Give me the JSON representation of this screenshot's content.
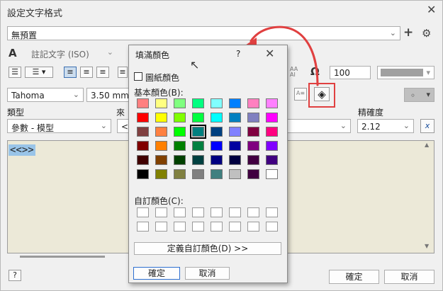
{
  "window": {
    "title": "設定文字格式"
  },
  "style_combo": {
    "value": "無預置"
  },
  "text_style": {
    "value": "註記文字 (ISO)"
  },
  "font": {
    "value": "Tahoma"
  },
  "size": {
    "value": "3.50 mm"
  },
  "width_value": "100",
  "type_label": "類型",
  "source_label_partial": "來",
  "type_combo": {
    "value": "參數 - 模型"
  },
  "precision_label": "精確度",
  "precision_combo": {
    "value": "2.12"
  },
  "source_partial_value": "<",
  "editor_text": "<<>>",
  "small_combo_value": "◦",
  "footer": {
    "ok": "確定",
    "cancel": "取消"
  },
  "popup": {
    "title": "填滿顏色",
    "help": "?",
    "checkbox_label": "圖紙顏色",
    "basic_label": "基本顏色(B):",
    "custom_label": "自訂顏色(C):",
    "define_button": "定義自訂顏色(D) >>",
    "ok": "確定",
    "cancel": "取消"
  },
  "colors": {
    "basic": [
      [
        "#ff8080",
        "#ffff80",
        "#80ff80",
        "#00ff80",
        "#80ffff",
        "#0080ff",
        "#ff80c0",
        "#ff80ff"
      ],
      [
        "#ff0000",
        "#ffff00",
        "#80ff00",
        "#00ff40",
        "#00ffff",
        "#0080c0",
        "#8080c0",
        "#ff00ff"
      ],
      [
        "#804040",
        "#ff8040",
        "#00ff00",
        "#008080",
        "#004080",
        "#8080ff",
        "#800040",
        "#ff0080"
      ],
      [
        "#800000",
        "#ff8000",
        "#008000",
        "#008040",
        "#0000ff",
        "#0000a0",
        "#800080",
        "#8000ff"
      ],
      [
        "#400000",
        "#804000",
        "#004000",
        "#004040",
        "#000080",
        "#000040",
        "#400040",
        "#400080"
      ],
      [
        "#000000",
        "#808000",
        "#808040",
        "#808080",
        "#408080",
        "#c0c0c0",
        "#400040",
        "#ffffff"
      ]
    ],
    "highlight_box": "#e04040",
    "arrow": "#e04040",
    "selection": "#99c4e8",
    "editor_bg": "#ece9d8"
  }
}
